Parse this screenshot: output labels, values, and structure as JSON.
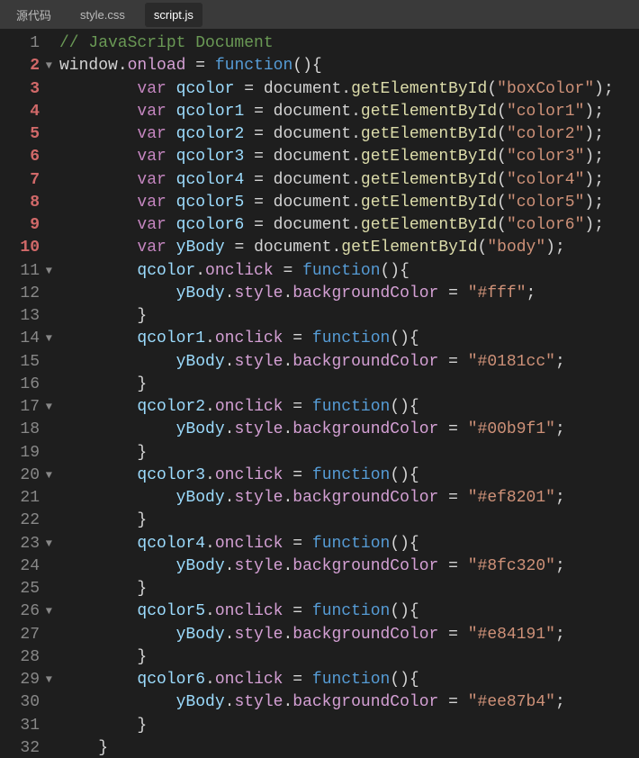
{
  "tabs": {
    "source": "源代码",
    "style": "style.css",
    "script": "script.js",
    "active": 2
  },
  "gutter": {
    "lines": [
      {
        "n": "1",
        "err": false,
        "fold": ""
      },
      {
        "n": "2",
        "err": true,
        "fold": "▼"
      },
      {
        "n": "3",
        "err": true,
        "fold": ""
      },
      {
        "n": "4",
        "err": true,
        "fold": ""
      },
      {
        "n": "5",
        "err": true,
        "fold": ""
      },
      {
        "n": "6",
        "err": true,
        "fold": ""
      },
      {
        "n": "7",
        "err": true,
        "fold": ""
      },
      {
        "n": "8",
        "err": true,
        "fold": ""
      },
      {
        "n": "9",
        "err": true,
        "fold": ""
      },
      {
        "n": "10",
        "err": true,
        "fold": ""
      },
      {
        "n": "11",
        "err": false,
        "fold": "▼"
      },
      {
        "n": "12",
        "err": false,
        "fold": ""
      },
      {
        "n": "13",
        "err": false,
        "fold": ""
      },
      {
        "n": "14",
        "err": false,
        "fold": "▼"
      },
      {
        "n": "15",
        "err": false,
        "fold": ""
      },
      {
        "n": "16",
        "err": false,
        "fold": ""
      },
      {
        "n": "17",
        "err": false,
        "fold": "▼"
      },
      {
        "n": "18",
        "err": false,
        "fold": ""
      },
      {
        "n": "19",
        "err": false,
        "fold": ""
      },
      {
        "n": "20",
        "err": false,
        "fold": "▼"
      },
      {
        "n": "21",
        "err": false,
        "fold": ""
      },
      {
        "n": "22",
        "err": false,
        "fold": ""
      },
      {
        "n": "23",
        "err": false,
        "fold": "▼"
      },
      {
        "n": "24",
        "err": false,
        "fold": ""
      },
      {
        "n": "25",
        "err": false,
        "fold": ""
      },
      {
        "n": "26",
        "err": false,
        "fold": "▼"
      },
      {
        "n": "27",
        "err": false,
        "fold": ""
      },
      {
        "n": "28",
        "err": false,
        "fold": ""
      },
      {
        "n": "29",
        "err": false,
        "fold": "▼"
      },
      {
        "n": "30",
        "err": false,
        "fold": ""
      },
      {
        "n": "31",
        "err": false,
        "fold": ""
      },
      {
        "n": "32",
        "err": false,
        "fold": ""
      }
    ]
  },
  "code": {
    "comment": "// JavaScript Document",
    "window": "window",
    "onload": "onload",
    "var": "var",
    "document": "document",
    "getElementById": "getElementById",
    "function": "function",
    "onclick": "onclick",
    "style": "style",
    "backgroundColor": "backgroundColor",
    "eq": " = ",
    "dot": ".",
    "op_paren": "()",
    "ob": "{",
    "cb": "}",
    "semi": ";",
    "vars": {
      "qcolor": "qcolor",
      "qcolor1": "qcolor1",
      "qcolor2": "qcolor2",
      "qcolor3": "qcolor3",
      "qcolor4": "qcolor4",
      "qcolor5": "qcolor5",
      "qcolor6": "qcolor6",
      "yBody": "yBody"
    },
    "ids": {
      "boxColor": "\"boxColor\"",
      "color1": "\"color1\"",
      "color2": "\"color2\"",
      "color3": "\"color3\"",
      "color4": "\"color4\"",
      "color5": "\"color5\"",
      "color6": "\"color6\"",
      "body": "\"body\""
    },
    "colors": {
      "fff": "\"#fff\"",
      "c0181cc": "\"#0181cc\"",
      "c00b9f1": "\"#00b9f1\"",
      "cef8201": "\"#ef8201\"",
      "c8fc320": "\"#8fc320\"",
      "ce84191": "\"#e84191\"",
      "cee87b4": "\"#ee87b4\""
    }
  }
}
